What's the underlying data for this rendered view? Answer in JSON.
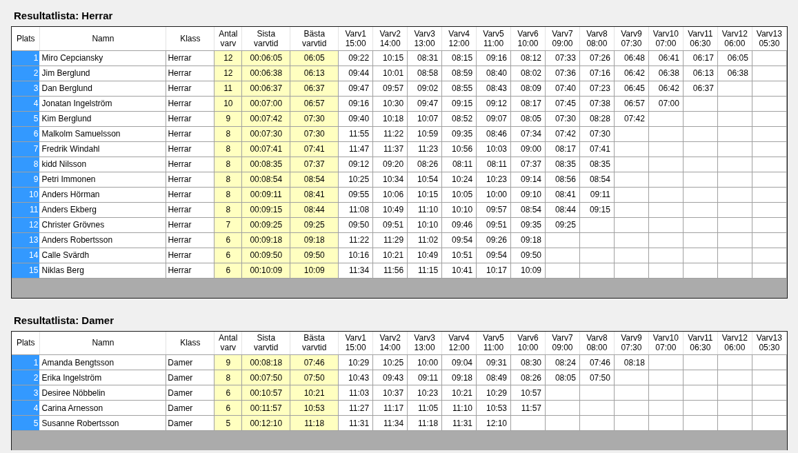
{
  "sections": [
    {
      "title": "Resultatlista: Herrar",
      "columns": [
        "Plats",
        "Namn",
        "Klass",
        "Antal\nvarv",
        "Sista\nvarvtid",
        "Bästa\nvarvtid",
        "Varv1\n15:00",
        "Varv2\n14:00",
        "Varv3\n13:00",
        "Varv4\n12:00",
        "Varv5\n11:00",
        "Varv6\n10:00",
        "Varv7\n09:00",
        "Varv8\n08:00",
        "Varv9\n07:30",
        "Varv10\n07:00",
        "Varv11\n06:30",
        "Varv12\n06:00",
        "Varv13\n05:30"
      ],
      "rows": [
        {
          "plats": "1",
          "name": "Miro Cepciansky",
          "klass": "Herrar",
          "laps": "12",
          "last": "00:06:05",
          "best": "06:05",
          "times": [
            "09:22",
            "10:15",
            "08:31",
            "08:15",
            "09:16",
            "08:12",
            "07:33",
            "07:26",
            "06:48",
            "06:41",
            "06:17",
            "06:05"
          ]
        },
        {
          "plats": "2",
          "name": "Jim Berglund",
          "klass": "Herrar",
          "laps": "12",
          "last": "00:06:38",
          "best": "06:13",
          "times": [
            "09:44",
            "10:01",
            "08:58",
            "08:59",
            "08:40",
            "08:02",
            "07:36",
            "07:16",
            "06:42",
            "06:38",
            "06:13",
            "06:38"
          ]
        },
        {
          "plats": "3",
          "name": "Dan Berglund",
          "klass": "Herrar",
          "laps": "11",
          "last": "00:06:37",
          "best": "06:37",
          "times": [
            "09:47",
            "09:57",
            "09:02",
            "08:55",
            "08:43",
            "08:09",
            "07:40",
            "07:23",
            "06:45",
            "06:42",
            "06:37"
          ]
        },
        {
          "plats": "4",
          "name": "Jonatan Ingelström",
          "klass": "Herrar",
          "laps": "10",
          "last": "00:07:00",
          "best": "06:57",
          "times": [
            "09:16",
            "10:30",
            "09:47",
            "09:15",
            "09:12",
            "08:17",
            "07:45",
            "07:38",
            "06:57",
            "07:00"
          ]
        },
        {
          "plats": "5",
          "name": "Kim Berglund",
          "klass": "Herrar",
          "laps": "9",
          "last": "00:07:42",
          "best": "07:30",
          "times": [
            "09:40",
            "10:18",
            "10:07",
            "08:52",
            "09:07",
            "08:05",
            "07:30",
            "08:28",
            "07:42"
          ]
        },
        {
          "plats": "6",
          "name": "Malkolm Samuelsson",
          "klass": "Herrar",
          "laps": "8",
          "last": "00:07:30",
          "best": "07:30",
          "times": [
            "11:55",
            "11:22",
            "10:59",
            "09:35",
            "08:46",
            "07:34",
            "07:42",
            "07:30"
          ]
        },
        {
          "plats": "7",
          "name": "Fredrik Windahl",
          "klass": "Herrar",
          "laps": "8",
          "last": "00:07:41",
          "best": "07:41",
          "times": [
            "11:47",
            "11:37",
            "11:23",
            "10:56",
            "10:03",
            "09:00",
            "08:17",
            "07:41"
          ]
        },
        {
          "plats": "8",
          "name": "kidd Nilsson",
          "klass": "Herrar",
          "laps": "8",
          "last": "00:08:35",
          "best": "07:37",
          "times": [
            "09:12",
            "09:20",
            "08:26",
            "08:11",
            "08:11",
            "07:37",
            "08:35",
            "08:35"
          ]
        },
        {
          "plats": "9",
          "name": "Petri Immonen",
          "klass": "Herrar",
          "laps": "8",
          "last": "00:08:54",
          "best": "08:54",
          "times": [
            "10:25",
            "10:34",
            "10:54",
            "10:24",
            "10:23",
            "09:14",
            "08:56",
            "08:54"
          ]
        },
        {
          "plats": "10",
          "name": "Anders Hörman",
          "klass": "Herrar",
          "laps": "8",
          "last": "00:09:11",
          "best": "08:41",
          "times": [
            "09:55",
            "10:06",
            "10:15",
            "10:05",
            "10:00",
            "09:10",
            "08:41",
            "09:11"
          ]
        },
        {
          "plats": "11",
          "name": "Anders Ekberg",
          "klass": "Herrar",
          "laps": "8",
          "last": "00:09:15",
          "best": "08:44",
          "times": [
            "11:08",
            "10:49",
            "11:10",
            "10:10",
            "09:57",
            "08:54",
            "08:44",
            "09:15"
          ]
        },
        {
          "plats": "12",
          "name": "Christer Grövnes",
          "klass": "Herrar",
          "laps": "7",
          "last": "00:09:25",
          "best": "09:25",
          "times": [
            "09:50",
            "09:51",
            "10:10",
            "09:46",
            "09:51",
            "09:35",
            "09:25"
          ]
        },
        {
          "plats": "13",
          "name": "Anders Robertsson",
          "klass": "Herrar",
          "laps": "6",
          "last": "00:09:18",
          "best": "09:18",
          "times": [
            "11:22",
            "11:29",
            "11:02",
            "09:54",
            "09:26",
            "09:18"
          ]
        },
        {
          "plats": "14",
          "name": "Calle Svärdh",
          "klass": "Herrar",
          "laps": "6",
          "last": "00:09:50",
          "best": "09:50",
          "times": [
            "10:16",
            "10:21",
            "10:49",
            "10:51",
            "09:54",
            "09:50"
          ]
        },
        {
          "plats": "15",
          "name": "Niklas Berg",
          "klass": "Herrar",
          "laps": "6",
          "last": "00:10:09",
          "best": "10:09",
          "times": [
            "11:34",
            "11:56",
            "11:15",
            "10:41",
            "10:17",
            "10:09"
          ]
        }
      ]
    },
    {
      "title": "Resultatlista: Damer",
      "columns": [
        "Plats",
        "Namn",
        "Klass",
        "Antal\nvarv",
        "Sista\nvarvtid",
        "Bästa\nvarvtid",
        "Varv1\n15:00",
        "Varv2\n14:00",
        "Varv3\n13:00",
        "Varv4\n12:00",
        "Varv5\n11:00",
        "Varv6\n10:00",
        "Varv7\n09:00",
        "Varv8\n08:00",
        "Varv9\n07:30",
        "Varv10\n07:00",
        "Varv11\n06:30",
        "Varv12\n06:00",
        "Varv13\n05:30"
      ],
      "rows": [
        {
          "plats": "1",
          "name": "Amanda Bengtsson",
          "klass": "Damer",
          "laps": "9",
          "last": "00:08:18",
          "best": "07:46",
          "times": [
            "10:29",
            "10:25",
            "10:00",
            "09:04",
            "09:31",
            "08:30",
            "08:24",
            "07:46",
            "08:18"
          ]
        },
        {
          "plats": "2",
          "name": "Erika Ingelström",
          "klass": "Damer",
          "laps": "8",
          "last": "00:07:50",
          "best": "07:50",
          "times": [
            "10:43",
            "09:43",
            "09:11",
            "09:18",
            "08:49",
            "08:26",
            "08:05",
            "07:50"
          ]
        },
        {
          "plats": "3",
          "name": "Desiree Nöbbelin",
          "klass": "Damer",
          "laps": "6",
          "last": "00:10:57",
          "best": "10:21",
          "times": [
            "11:03",
            "10:37",
            "10:23",
            "10:21",
            "10:29",
            "10:57"
          ]
        },
        {
          "plats": "4",
          "name": "Carina Arnesson",
          "klass": "Damer",
          "laps": "6",
          "last": "00:11:57",
          "best": "10:53",
          "times": [
            "11:27",
            "11:17",
            "11:05",
            "11:10",
            "10:53",
            "11:57"
          ]
        },
        {
          "plats": "5",
          "name": "Susanne Robertsson",
          "klass": "Damer",
          "laps": "5",
          "last": "00:12:10",
          "best": "11:18",
          "times": [
            "11:31",
            "11:34",
            "11:18",
            "11:31",
            "12:10"
          ]
        }
      ]
    }
  ]
}
